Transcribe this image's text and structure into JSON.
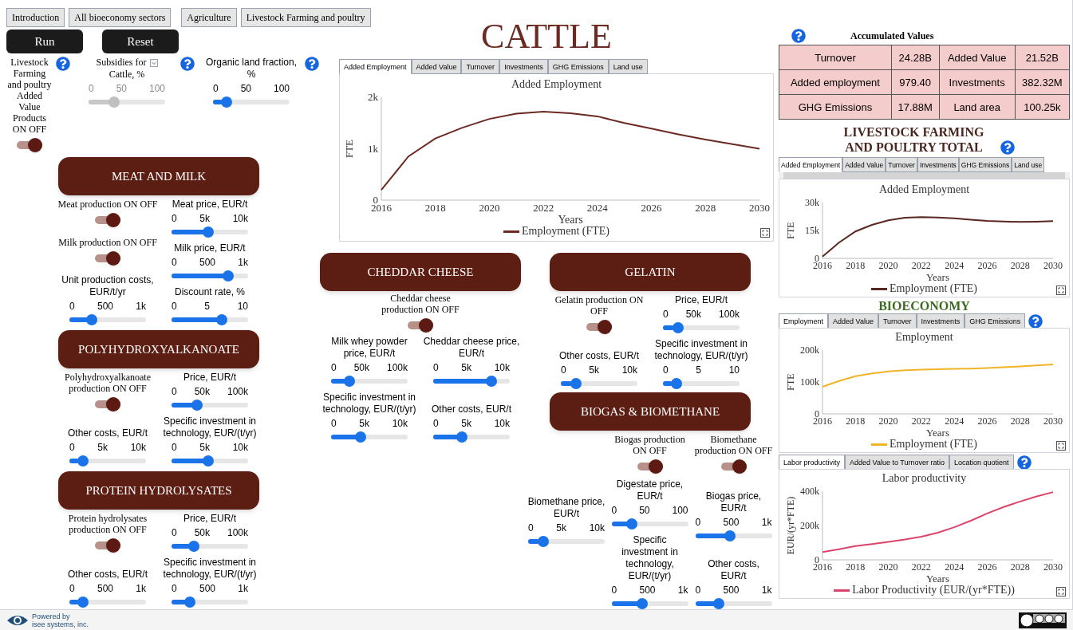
{
  "nav_tabs": [
    "Introduction",
    "All bioeconomy sectors",
    "Agriculture",
    "Livestock Farming and poultry"
  ],
  "actions": [
    "Run",
    "Reset"
  ],
  "title": "CATTLE",
  "top_controls": [
    {
      "kind": "toggle",
      "label": "Livestock Farming and poultry Added Value Products ON OFF",
      "on": true
    },
    {
      "kind": "slider",
      "label": "Subsidies for",
      "label_after": "Cattle, %",
      "ticks": [
        "0",
        "50",
        "100"
      ],
      "level": 0.3,
      "disabled": true
    },
    {
      "kind": "slider",
      "label": "Organic land fraction, %",
      "ticks": [
        "0",
        "50",
        "100"
      ],
      "level": 0.12,
      "disabled": false
    }
  ],
  "sections_left": [
    {
      "title": "MEAT AND MILK",
      "columns": [
        [
          {
            "kind": "toggle",
            "label": "Meat production ON OFF",
            "on": true
          },
          {
            "kind": "toggle",
            "label": "Milk production ON OFF",
            "on": true
          },
          {
            "kind": "slider",
            "label": "Unit production costs, EUR/t/yr",
            "ticks": [
              "0",
              "500",
              "1k"
            ],
            "level": 0.25
          }
        ],
        [
          {
            "kind": "slider",
            "label": "Meat price, EUR/t",
            "ticks": [
              "0",
              "5k",
              "10k"
            ],
            "level": 0.47
          },
          {
            "kind": "slider",
            "label": "Milk price, EUR/t",
            "ticks": [
              "0",
              "500",
              "1k"
            ],
            "level": 0.78
          },
          {
            "kind": "slider",
            "label": "Discount rate, %",
            "ticks": [
              "0",
              "5",
              "10"
            ],
            "level": 0.68
          }
        ]
      ]
    },
    {
      "title": "POLYHYDROXYALKANOATE",
      "columns": [
        [
          {
            "kind": "toggle",
            "label": "Polyhydroxyalkanoate production ON OFF",
            "on": true
          },
          {
            "kind": "slider",
            "label": "Other costs, EUR/t",
            "ticks": [
              "0",
              "5k",
              "10k"
            ],
            "level": 0.12
          }
        ],
        [
          {
            "kind": "slider",
            "label": "Price, EUR/t",
            "ticks": [
              "0",
              "50k",
              "100k"
            ],
            "level": 0.3
          },
          {
            "kind": "slider",
            "label": "Specific investment in technology, EUR/(t/yr)",
            "ticks": [
              "0",
              "5k",
              "10k"
            ],
            "level": 0.47
          }
        ]
      ]
    },
    {
      "title": "PROTEIN HYDROLYSATES",
      "columns": [
        [
          {
            "kind": "toggle",
            "label": "Protein hydrolysates production ON OFF",
            "on": true
          },
          {
            "kind": "slider",
            "label": "Other costs, EUR/t",
            "ticks": [
              "0",
              "500",
              "1k"
            ],
            "level": 0.12
          }
        ],
        [
          {
            "kind": "slider",
            "label": "Price, EUR/t",
            "ticks": [
              "0",
              "50k",
              "100k"
            ],
            "level": 0.25
          },
          {
            "kind": "slider",
            "label": "Specific investment in technology, EUR/(t/yr)",
            "ticks": [
              "0",
              "500",
              "1k"
            ],
            "level": 0.2
          }
        ]
      ]
    }
  ],
  "main_chart": {
    "tabs": [
      {
        "label": "Added Employment",
        "selected": true
      },
      {
        "label": "Added Value",
        "selected": false
      },
      {
        "label": "Turnover",
        "selected": false
      },
      {
        "label": "Investments",
        "selected": false
      },
      {
        "label": "GHG Emissions",
        "selected": false
      },
      {
        "label": "Land use",
        "selected": false
      }
    ],
    "chart_data": {
      "type": "line",
      "title": "Added Employment",
      "xlabel": "Years",
      "ylabel": "FTE",
      "x": [
        2016,
        2017,
        2018,
        2019,
        2020,
        2021,
        2022,
        2023,
        2024,
        2025,
        2026,
        2027,
        2028,
        2029,
        2030
      ],
      "xlim": [
        2016,
        2030
      ],
      "ylim": [
        0,
        2000
      ],
      "xticks": [
        2016,
        2018,
        2020,
        2022,
        2024,
        2026,
        2028,
        2030
      ],
      "yticks": [
        0,
        {
          "value": 1000,
          "label": "1k"
        },
        {
          "value": 2000,
          "label": "2k"
        }
      ],
      "series": [
        {
          "name": "Employment (FTE)",
          "color": "#6b2a22",
          "values": [
            200,
            850,
            1200,
            1410,
            1580,
            1680,
            1720,
            1690,
            1630,
            1500,
            1390,
            1280,
            1180,
            1090,
            1000
          ]
        }
      ]
    }
  },
  "sections_middle": [
    {
      "title": "CHEDDAR CHEESE",
      "toggle": {
        "label": "Cheddar cheese production ON OFF",
        "on": true
      },
      "columns": [
        [
          {
            "kind": "slider",
            "label": "Milk whey powder price, EUR/t",
            "ticks": [
              "0",
              "50k",
              "100k"
            ],
            "level": 0.2
          },
          {
            "kind": "slider",
            "label": "Specific investment in technology, EUR/(t/yr)",
            "ticks": [
              "0",
              "5k",
              "10k"
            ],
            "level": 0.37
          }
        ],
        [
          {
            "kind": "slider",
            "label": "Cheddar cheese price, EUR/t",
            "ticks": [
              "0",
              "5k",
              "10k"
            ],
            "level": 0.8
          },
          {
            "kind": "slider",
            "label": "Other costs, EUR/t",
            "ticks": [
              "0",
              "5k",
              "10k"
            ],
            "level": 0.35
          }
        ]
      ]
    }
  ],
  "sections_right": [
    {
      "title": "GELATIN",
      "columns": [
        [
          {
            "kind": "toggle",
            "label": "Gelatin production ON OFF",
            "on": true
          },
          {
            "kind": "slider",
            "label": "Other costs, EUR/t",
            "ticks": [
              "0",
              "5k",
              "10k"
            ],
            "level": 0.15
          }
        ],
        [
          {
            "kind": "slider",
            "label": "Price, EUR/t",
            "ticks": [
              "0",
              "50k",
              "100k"
            ],
            "level": 0.15
          },
          {
            "kind": "slider",
            "label": "Specific investment in technology, EUR/(t/yr)",
            "ticks": [
              "0",
              "5",
              "10"
            ],
            "level": 0.12
          }
        ]
      ]
    },
    {
      "title": "BIOGAS & BIOMETHANE",
      "columns": [
        [
          {
            "kind": "slider",
            "label": "Biomethane price, EUR/t",
            "ticks": [
              "0",
              "5k",
              "10k"
            ],
            "level": 0.15
          }
        ],
        [
          {
            "kind": "toggle",
            "label": "Biogas production ON OFF",
            "on": true
          },
          {
            "kind": "slider",
            "label": "Digestate price, EUR/t",
            "ticks": [
              "0",
              "50",
              "100"
            ],
            "level": 0.22
          },
          {
            "kind": "slider",
            "label": "Specific investment in technology, EUR/(t/yr)",
            "ticks": [
              "0",
              "500",
              "1k"
            ],
            "level": 0.38
          }
        ],
        [
          {
            "kind": "toggle",
            "label": "Biomethane production ON OFF",
            "on": true
          },
          {
            "kind": "slider",
            "label": "Biogas price, EUR/t",
            "ticks": [
              "0",
              "500",
              "1k"
            ],
            "level": 0.45
          },
          {
            "kind": "slider",
            "label": "Other costs, EUR/t",
            "ticks": [
              "0",
              "500",
              "1k"
            ],
            "level": 0.28
          }
        ]
      ]
    }
  ],
  "accumulated": {
    "title": "Accumulated Values",
    "rows": [
      [
        "Turnover",
        "24.28B",
        "Added Value",
        "21.52B"
      ],
      [
        "Added employment",
        "979.40",
        "Investments",
        "382.32M"
      ],
      [
        "GHG Emissions",
        "17.88M",
        "Land area",
        "100.25k"
      ]
    ]
  },
  "livestock_panel": {
    "heading": "LIVESTOCK FARMING AND POULTRY TOTAL",
    "tabs": [
      {
        "label": "Added Employment",
        "selected": true
      },
      {
        "label": "Added Value",
        "selected": false
      },
      {
        "label": "Turnover",
        "selected": false
      },
      {
        "label": "Investments",
        "selected": false
      },
      {
        "label": "GHG Emissions",
        "selected": false
      },
      {
        "label": "Land use",
        "selected": false
      }
    ],
    "chart_data": {
      "type": "line",
      "title": "Added Employment",
      "xlabel": "Years",
      "ylabel": "FTE",
      "x": [
        2016,
        2017,
        2018,
        2019,
        2020,
        2021,
        2022,
        2023,
        2024,
        2025,
        2026,
        2027,
        2028,
        2029,
        2030
      ],
      "xlim": [
        2016,
        2030
      ],
      "ylim": [
        0,
        30000
      ],
      "xticks": [
        2016,
        2018,
        2020,
        2022,
        2024,
        2026,
        2028,
        2030
      ],
      "yticks": [
        0,
        {
          "value": 15000,
          "label": "15k"
        },
        {
          "value": 30000,
          "label": "30k"
        }
      ],
      "series": [
        {
          "name": "Employment (FTE)",
          "color": "#5a2620",
          "values": [
            1000,
            8500,
            14500,
            18000,
            20500,
            21800,
            22200,
            22000,
            21500,
            20800,
            20200,
            19800,
            19600,
            19700,
            20000
          ]
        }
      ]
    }
  },
  "bioeconomy_panel": {
    "heading": "BIOECONOMY",
    "tabs": [
      {
        "label": "Employment",
        "selected": true
      },
      {
        "label": "Added Value",
        "selected": false
      },
      {
        "label": "Turnover",
        "selected": false
      },
      {
        "label": "Investments",
        "selected": false
      },
      {
        "label": "GHG Emissions",
        "selected": false
      }
    ],
    "chart_data": {
      "type": "line",
      "title": "Employment",
      "xlabel": "Years",
      "ylabel": "FTE",
      "x": [
        2016,
        2017,
        2018,
        2019,
        2020,
        2021,
        2022,
        2023,
        2024,
        2025,
        2026,
        2027,
        2028,
        2029,
        2030
      ],
      "xlim": [
        2016,
        2030
      ],
      "ylim": [
        0,
        200000
      ],
      "xticks": [
        2016,
        2018,
        2020,
        2022,
        2024,
        2026,
        2028,
        2030
      ],
      "yticks": [
        0,
        {
          "value": 100000,
          "label": "100k"
        },
        {
          "value": 200000,
          "label": "200k"
        }
      ],
      "series": [
        {
          "name": "Employment (FTE)",
          "color": "#f0b429",
          "values": [
            85000,
            103000,
            118000,
            127000,
            133000,
            137000,
            139000,
            140000,
            141000,
            142000,
            144000,
            146000,
            149000,
            152000,
            155000
          ]
        }
      ]
    }
  },
  "productivity_panel": {
    "tabs": [
      {
        "label": "Labor productivity",
        "selected": true
      },
      {
        "label": "Added Value to Turnover ratio",
        "selected": false
      },
      {
        "label": "Location quotient",
        "selected": false
      }
    ],
    "chart_data": {
      "type": "line",
      "title": "Labor productivity",
      "xlabel": "Years",
      "ylabel": "EUR/(yr*FTE)",
      "x": [
        2016,
        2017,
        2018,
        2019,
        2020,
        2021,
        2022,
        2023,
        2024,
        2025,
        2026,
        2027,
        2028,
        2029,
        2030
      ],
      "xlim": [
        2016,
        2030
      ],
      "ylim": [
        0,
        400000
      ],
      "xticks": [
        2016,
        2018,
        2020,
        2022,
        2024,
        2026,
        2028,
        2030
      ],
      "yticks": [
        0,
        {
          "value": 200000,
          "label": "200k"
        },
        {
          "value": 400000,
          "label": "400k"
        }
      ],
      "series": [
        {
          "name": "Labor Productivity (EUR/(yr*FTE))",
          "color": "#d9456b",
          "values": [
            45000,
            62000,
            80000,
            92000,
            105000,
            118000,
            135000,
            158000,
            190000,
            228000,
            270000,
            308000,
            340000,
            370000,
            395000
          ]
        }
      ]
    }
  },
  "footer": {
    "powered_by": "Powered by",
    "company": "isee systems, inc."
  }
}
